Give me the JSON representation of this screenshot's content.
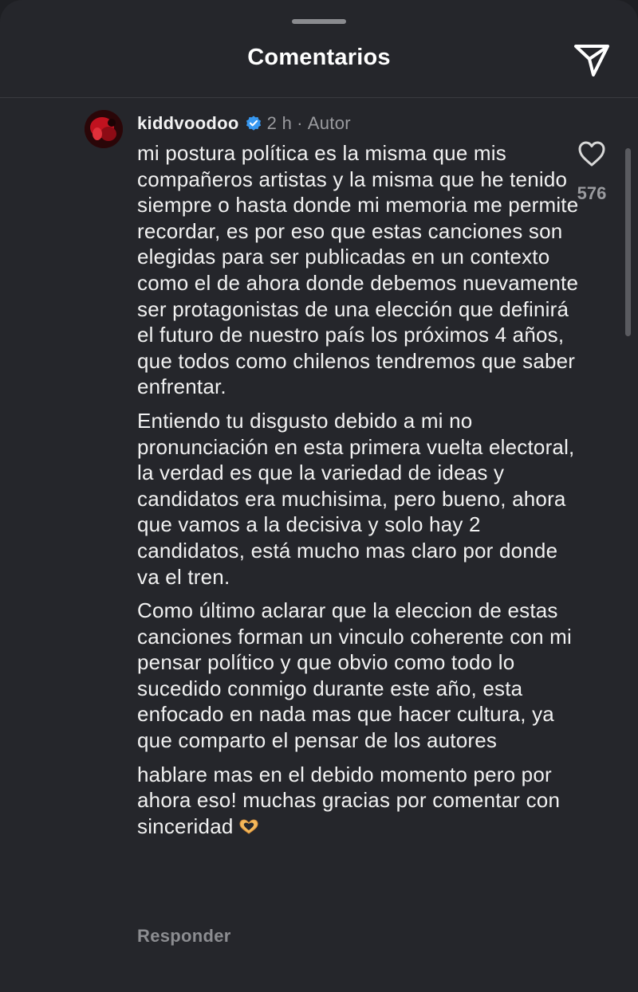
{
  "sheet": {
    "title": "Comentarios"
  },
  "comment": {
    "username": "kiddvoodoo",
    "time": "2 h",
    "separator": "·",
    "role": "Autor",
    "likes": "576",
    "paragraphs": [
      "mi postura política es la misma que mis compañeros artistas y la misma que he tenido siempre o hasta donde mi memoria me permite recordar,  es por eso que estas canciones son elegidas para ser publicadas en un contexto como el de ahora donde debemos nuevamente ser protagonistas de una elección que definirá el futuro de nuestro país los próximos 4 años, que todos como chilenos tendremos que saber  enfrentar.",
      "Entiendo tu disgusto debido a mi no pronunciación en esta primera vuelta electoral, la verdad es que la variedad de ideas y candidatos era muchisima, pero bueno, ahora que vamos a la decisiva y solo hay 2 candidatos, está mucho mas claro por donde va el tren.",
      "Como último aclarar que la eleccion de estas canciones forman un vinculo coherente con mi pensar político y que obvio como todo lo sucedido conmigo durante este año, esta enfocado en nada mas que hacer cultura, ya que comparto el pensar de los autores",
      "hablare mas en el debido momento pero por ahora eso! muchas gracias por comentar con sinceridad"
    ],
    "reply_label": "Responder",
    "accent_color": "#3797f0"
  }
}
